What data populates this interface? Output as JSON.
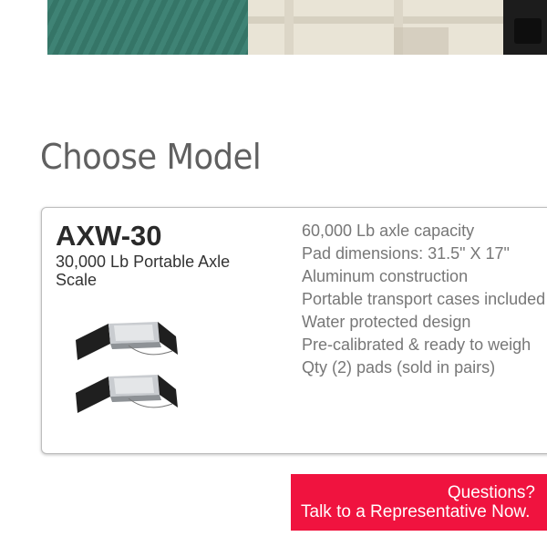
{
  "section_title": "Choose Model",
  "model": {
    "name": "AXW-30",
    "description": "30,000 Lb Portable Axle Scale",
    "image_label": "portable-axle-scale-pads",
    "features": [
      "60,000 Lb axle capacity",
      "Pad dimensions: 31.5\" X 17\"",
      "Aluminum construction",
      "Portable transport cases included",
      "Water protected design",
      "Pre-calibrated & ready to weigh",
      "Qty (2) pads (sold in pairs)"
    ]
  },
  "cta": {
    "line1": "Questions?",
    "line2": "Talk to a Representative Now."
  },
  "colors": {
    "cta_background": "#f0133f",
    "feature_text": "#777777"
  }
}
